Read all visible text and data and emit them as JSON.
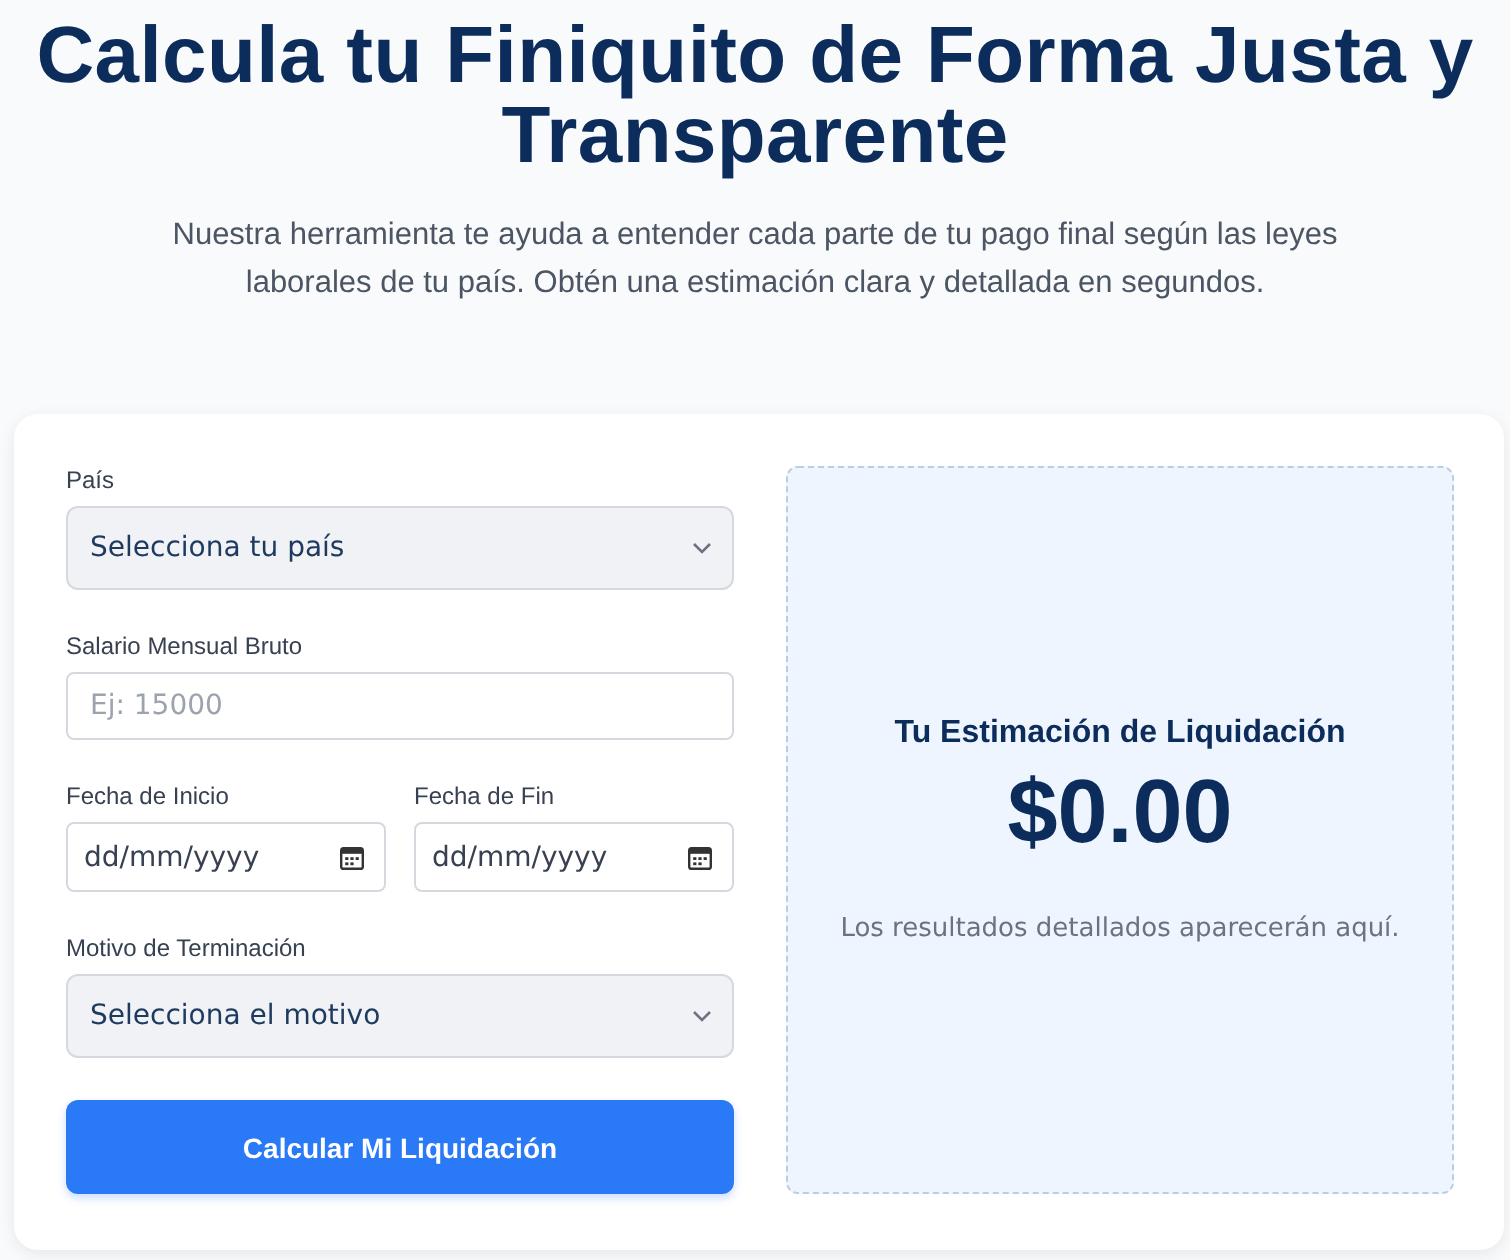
{
  "header": {
    "title": "Calcula tu Finiquito de Forma Justa y Transparente",
    "subtitle": "Nuestra herramienta te ayuda a entender cada parte de tu pago final según las leyes laborales de tu país. Obtén una estimación clara y detallada en segundos."
  },
  "form": {
    "fields": [
      {
        "kind": "select",
        "label": "País",
        "value": "Selecciona tu país"
      },
      {
        "kind": "text",
        "label": "Salario Mensual Bruto",
        "placeholder": "Ej: 15000"
      },
      {
        "kind": "date_pair",
        "items": [
          {
            "label": "Fecha de Inicio",
            "placeholder": "dd/mm/yyyy"
          },
          {
            "label": "Fecha de Fin",
            "placeholder": "dd/mm/yyyy"
          }
        ]
      },
      {
        "kind": "select",
        "label": "Motivo de Terminación",
        "value": "Selecciona el motivo"
      }
    ],
    "submit_button": "Calcular Mi Liquidación"
  },
  "result": {
    "title": "Tu Estimación de Liquidación",
    "amount": "$0.00",
    "note": "Los resultados detallados aparecerán aquí."
  }
}
